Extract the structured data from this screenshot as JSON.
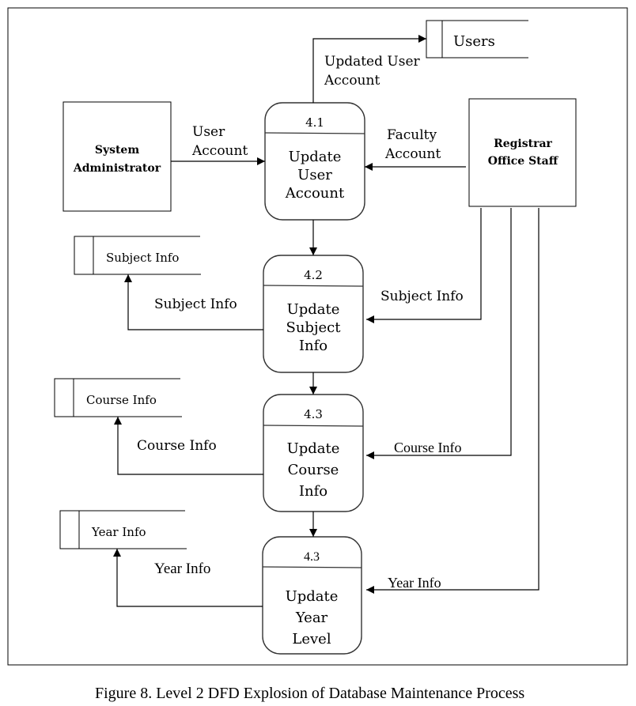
{
  "diagram": {
    "caption": "Figure 8. Level 2 DFD Explosion of Database Maintenance Process",
    "external_entities": [
      {
        "id": "sysadmin",
        "lines": [
          "System",
          "Administrator"
        ]
      },
      {
        "id": "registrar",
        "lines": [
          "Registrar",
          "Office Staff"
        ]
      }
    ],
    "processes": [
      {
        "id": "p41",
        "number": "4.1",
        "lines": [
          "Update",
          "User",
          "Account"
        ]
      },
      {
        "id": "p42",
        "number": "4.2",
        "lines": [
          "Update",
          "Subject",
          "Info"
        ]
      },
      {
        "id": "p43",
        "number": "4.3",
        "lines": [
          "Update",
          "Course",
          "Info"
        ]
      },
      {
        "id": "p44",
        "number": "4.3",
        "lines": [
          "Update",
          "Year",
          "Level"
        ]
      }
    ],
    "data_stores": [
      {
        "id": "users",
        "label": "Users"
      },
      {
        "id": "subject",
        "label": "Subject Info"
      },
      {
        "id": "course",
        "label": "Course Info"
      },
      {
        "id": "year",
        "label": "Year Info"
      }
    ],
    "flows": [
      {
        "from": "p41",
        "to": "users",
        "lines": [
          "Updated User",
          "Account"
        ]
      },
      {
        "from": "sysadmin",
        "to": "p41",
        "lines": [
          "User",
          "Account"
        ]
      },
      {
        "from": "registrar",
        "to": "p41",
        "lines": [
          "Faculty",
          "Account"
        ]
      },
      {
        "from": "p42",
        "to": "subject",
        "lines": [
          "Subject Info"
        ]
      },
      {
        "from": "registrar",
        "to": "p42",
        "lines": [
          "Subject Info"
        ]
      },
      {
        "from": "p43",
        "to": "course",
        "lines": [
          "Course Info"
        ]
      },
      {
        "from": "registrar",
        "to": "p43",
        "lines": [
          "Course Info"
        ]
      },
      {
        "from": "p44",
        "to": "year",
        "lines": [
          "Year Info"
        ]
      },
      {
        "from": "registrar",
        "to": "p44",
        "lines": [
          "Year Info"
        ]
      }
    ]
  }
}
